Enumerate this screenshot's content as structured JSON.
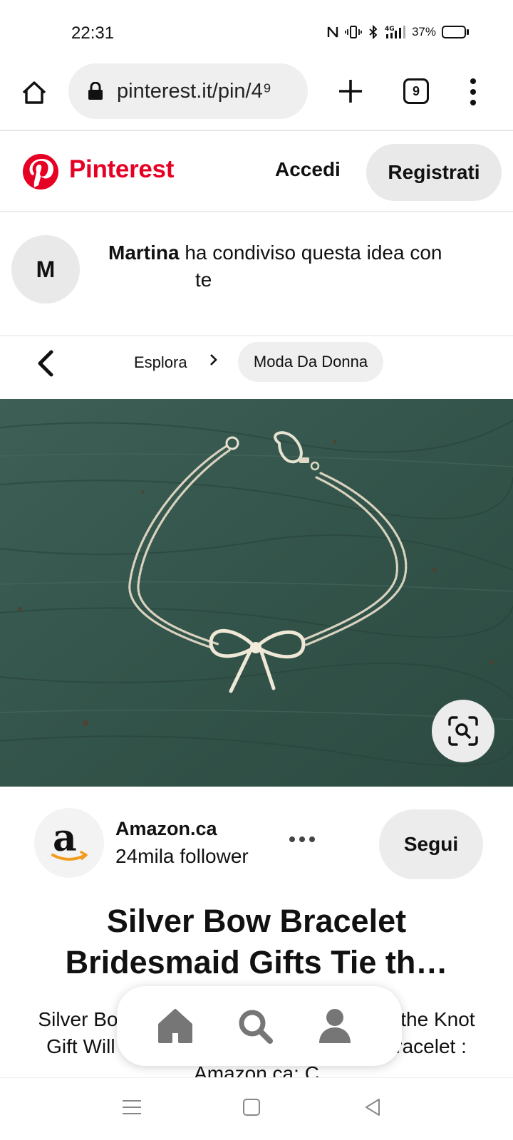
{
  "status_bar": {
    "time": "22:31",
    "indicators": "N ⎕ ✱ ⁴ᴳ",
    "battery_percent": "37%",
    "battery_level": 0.37
  },
  "browser": {
    "url": "pinterest.it/pin/4⁹",
    "tab_count": "9",
    "icons": [
      "home-icon",
      "lock-icon",
      "plus-icon",
      "tabs-icon",
      "more-vert-icon"
    ]
  },
  "header": {
    "brand": "Pinterest",
    "login_label": "Accedi",
    "signup_label": "Registrati",
    "brand_color": "#e60023"
  },
  "share": {
    "avatar_initial": "M",
    "sharer_name": "Martina",
    "message_line1": "ha condiviso questa idea con",
    "message_line2": "te"
  },
  "breadcrumb": {
    "explore_label": "Esplora",
    "category_label": "Moda Da Donna"
  },
  "pin": {
    "image_subject": "silver bow bracelet on green wooden surface",
    "creator_name": "Amazon.ca",
    "creator_followers": "24mila follower",
    "follow_label": "Segui",
    "title_line1": "Silver Bow Bracelet",
    "title_line2": "Bridesmaid Gifts Tie th…",
    "description": "Silver Bow Bracelet Bridesmaid Gifts Tie the Knot Gift Will You Be My Bridesmaid Silver Bracelet : Amazon.ca: C"
  },
  "bottom_nav": {
    "icons": [
      "home-icon",
      "search-icon",
      "profile-icon"
    ]
  },
  "system_nav": {
    "icons": [
      "recents-icon",
      "home-square-icon",
      "back-triangle-icon"
    ]
  }
}
